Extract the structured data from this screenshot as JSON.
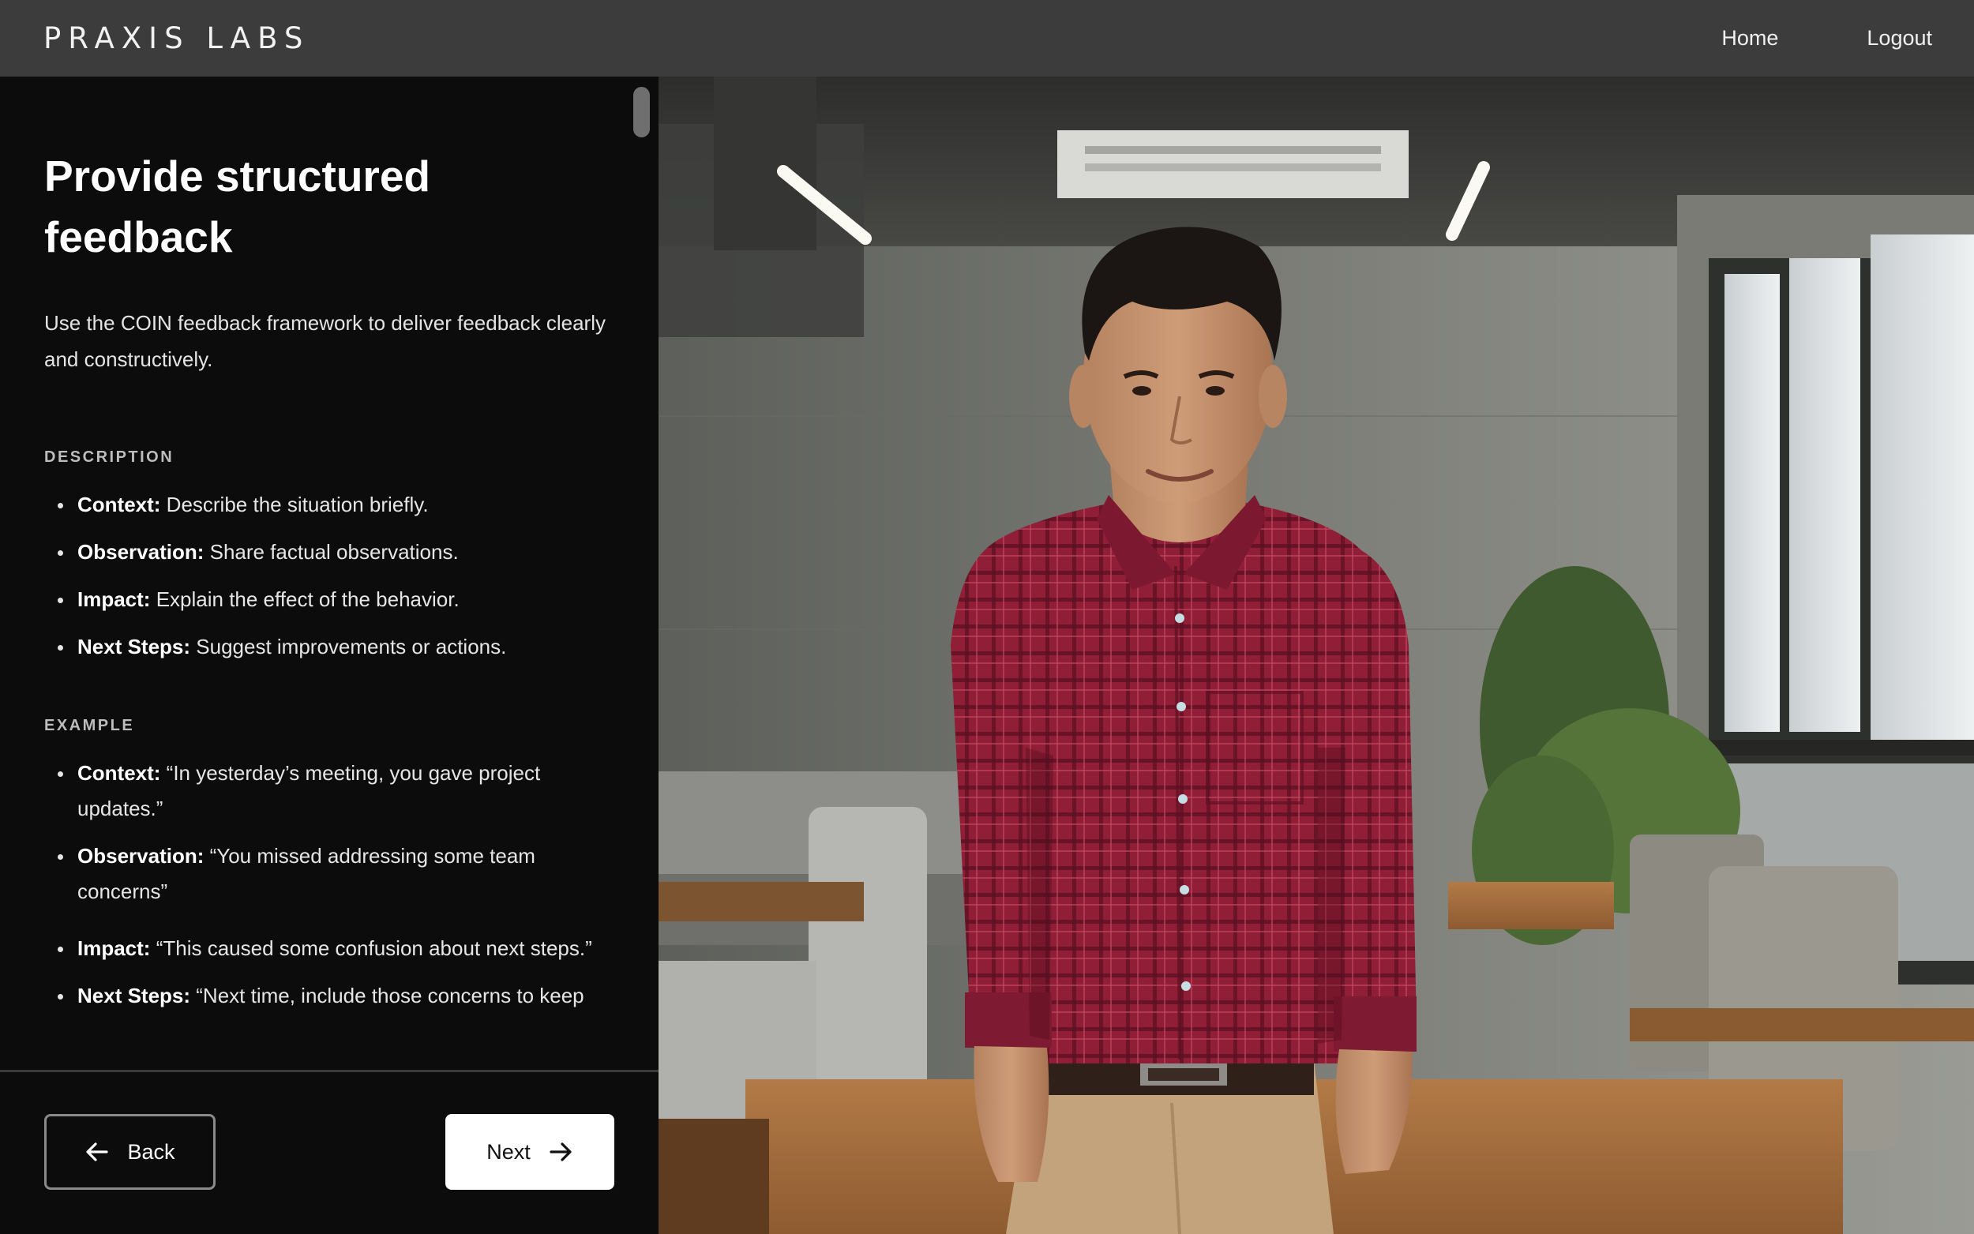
{
  "header": {
    "brand": "PRAXIS LABS",
    "nav": [
      {
        "label": "Home"
      },
      {
        "label": "Logout"
      }
    ]
  },
  "panel": {
    "title": "Provide structured feedback",
    "subtitle": "Use the COIN feedback framework to deliver feedback clearly and constructively.",
    "description_label": "DESCRIPTION",
    "description_items": [
      {
        "term": "Context:",
        "text": " Describe the situation briefly."
      },
      {
        "term": "Observation:",
        "text": " Share factual observations."
      },
      {
        "term": "Impact:",
        "text": " Explain the effect of the behavior."
      },
      {
        "term": "Next Steps:",
        "text": " Suggest improvements or actions."
      }
    ],
    "example_label": "EXAMPLE",
    "example_items": [
      {
        "term": "Context:",
        "text": " “In yesterday’s meeting, you gave project updates.”"
      },
      {
        "term": "Observation:",
        "text": " “You missed addressing some team concerns”"
      },
      {
        "term": "Impact:",
        "text": " “This caused some confusion about next steps.”"
      },
      {
        "term": "Next Steps:",
        "text": " “Next time, include those concerns to keep"
      }
    ]
  },
  "footer": {
    "back_label": "Back",
    "next_label": "Next"
  },
  "photo": {
    "icon": "portrait-photo"
  },
  "colors": {
    "topbar": "#3c3c3c",
    "panel": "#0c0c0c",
    "shirt": "#8e1f35",
    "next_button_bg": "#ffffff"
  }
}
